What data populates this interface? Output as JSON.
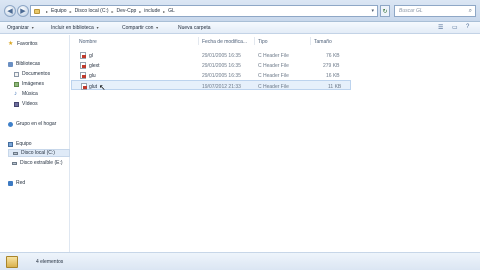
{
  "address": {
    "crumbs": [
      "Equipo",
      "Disco local (C:)",
      "Dev-Cpp",
      "include",
      "GL"
    ],
    "search_placeholder": "Buscar GL"
  },
  "toolbar": {
    "organize": "Organizar",
    "include_library": "Incluir en biblioteca",
    "share": "Compartir con",
    "new_folder": "Nueva carpeta"
  },
  "nav": {
    "favorites": "Favoritos",
    "libraries": "Bibliotecas",
    "documents": "Documentos",
    "images": "Imágenes",
    "music": "Música",
    "videos": "Vídeos",
    "homegroup": "Grupo en el hogar",
    "computer": "Equipo",
    "local_disk": "Disco local (C:)",
    "removable_disk": "Disco extraíble (E:)",
    "network": "Red"
  },
  "columns": {
    "name": "Nombre",
    "date": "Fecha de modifica...",
    "type": "Tipo",
    "size": "Tamaño"
  },
  "files": [
    {
      "name": "gl",
      "date": "29/01/2005 16:35",
      "type": "C Header File",
      "size": "76 KB"
    },
    {
      "name": "glext",
      "date": "29/01/2005 16:35",
      "type": "C Header File",
      "size": "279 KB"
    },
    {
      "name": "glu",
      "date": "29/01/2005 16:35",
      "type": "C Header File",
      "size": "16 KB"
    },
    {
      "name": "glut",
      "date": "19/07/2012 21:33",
      "type": "C Header File",
      "size": "11 KB"
    }
  ],
  "status": {
    "text": "4 elementos"
  }
}
